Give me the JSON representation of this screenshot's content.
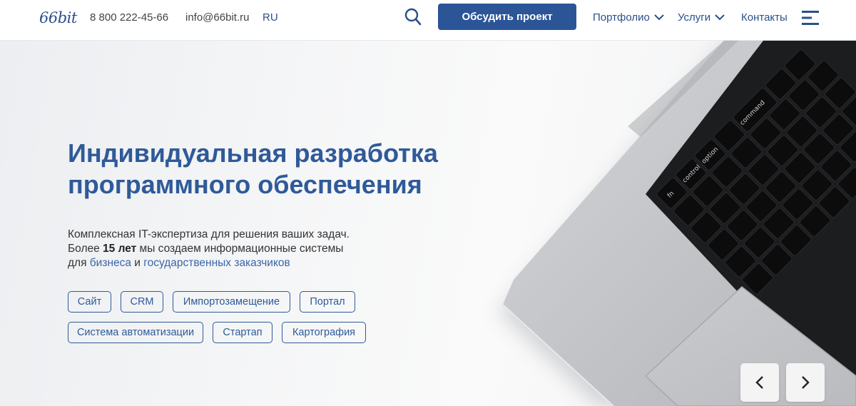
{
  "header": {
    "logo": "66bit",
    "phone": "8 800 222-45-66",
    "email": "info@66bit.ru",
    "lang": "RU",
    "cta_label": "Обсудить проект",
    "nav": {
      "portfolio": "Портфолио",
      "services": "Услуги",
      "contacts": "Контакты"
    }
  },
  "hero": {
    "title_line1": "Индивидуальная разработка",
    "title_line2": "программного обеспечения",
    "text_line1": "Комплексная IT-экспертиза для решения ваших задач.",
    "text_line2_a": "Более ",
    "text_line2_b": "15 лет",
    "text_line2_c": " мы создаем информационные системы",
    "text_line3_a": "для ",
    "text_line3_link1": "бизнеса",
    "text_line3_b": " и ",
    "text_line3_link2": "государственных заказчиков",
    "tags_row1": [
      "Сайт",
      "CRM",
      "Импортозамещение",
      "Портал"
    ],
    "tags_row2": [
      "Система автоматизации",
      "Стартап",
      "Картография"
    ]
  },
  "keyboard_labels": {
    "control": "control",
    "option": "option",
    "command": "command",
    "fn": "fn"
  },
  "colors": {
    "accent": "#2b5597",
    "text_accent": "#2f5a99"
  }
}
